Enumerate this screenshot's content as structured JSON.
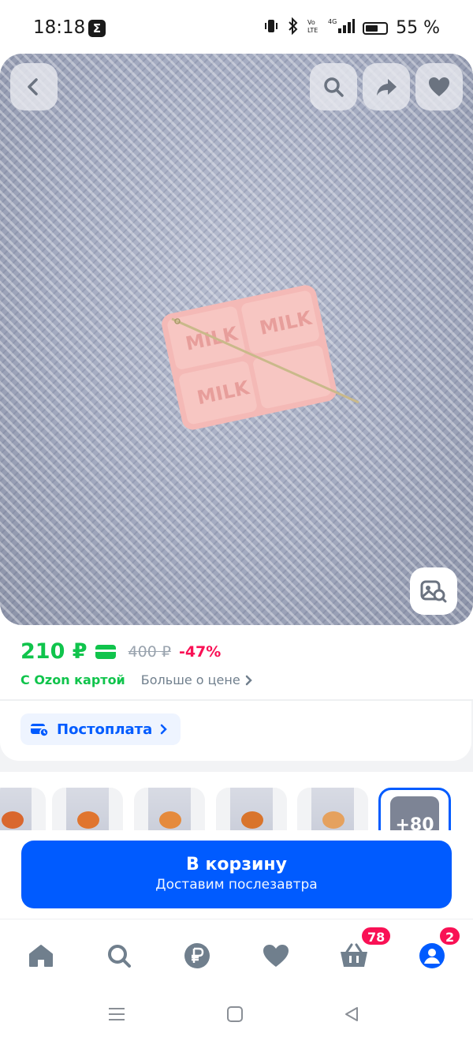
{
  "status_bar": {
    "time": "18:18",
    "app_icon_glyph": "Σ",
    "battery_percent": "55 %",
    "icons": [
      "vibrate-icon",
      "bluetooth-icon",
      "volte-icon",
      "signal-4g-icon",
      "battery-icon"
    ]
  },
  "product": {
    "image_alt": "pink chocolate-bar shaped item with MILK embossing on embroidery canvas with a needle"
  },
  "price": {
    "current": "210 ₽",
    "old": "400 ₽",
    "discount": "-47%",
    "card_label": "С Ozon картой",
    "more_label": "Больше о цене"
  },
  "postpay": {
    "label": "Постоплата"
  },
  "gallery": {
    "more_count": "+80"
  },
  "cart": {
    "label": "В корзину",
    "sublabel": "Доставим послезавтра"
  },
  "nav": {
    "cart_badge": "78",
    "profile_badge": "2"
  },
  "colors": {
    "accent": "#005bff",
    "price_green": "#10c44c",
    "discount_pink": "#f91155"
  }
}
